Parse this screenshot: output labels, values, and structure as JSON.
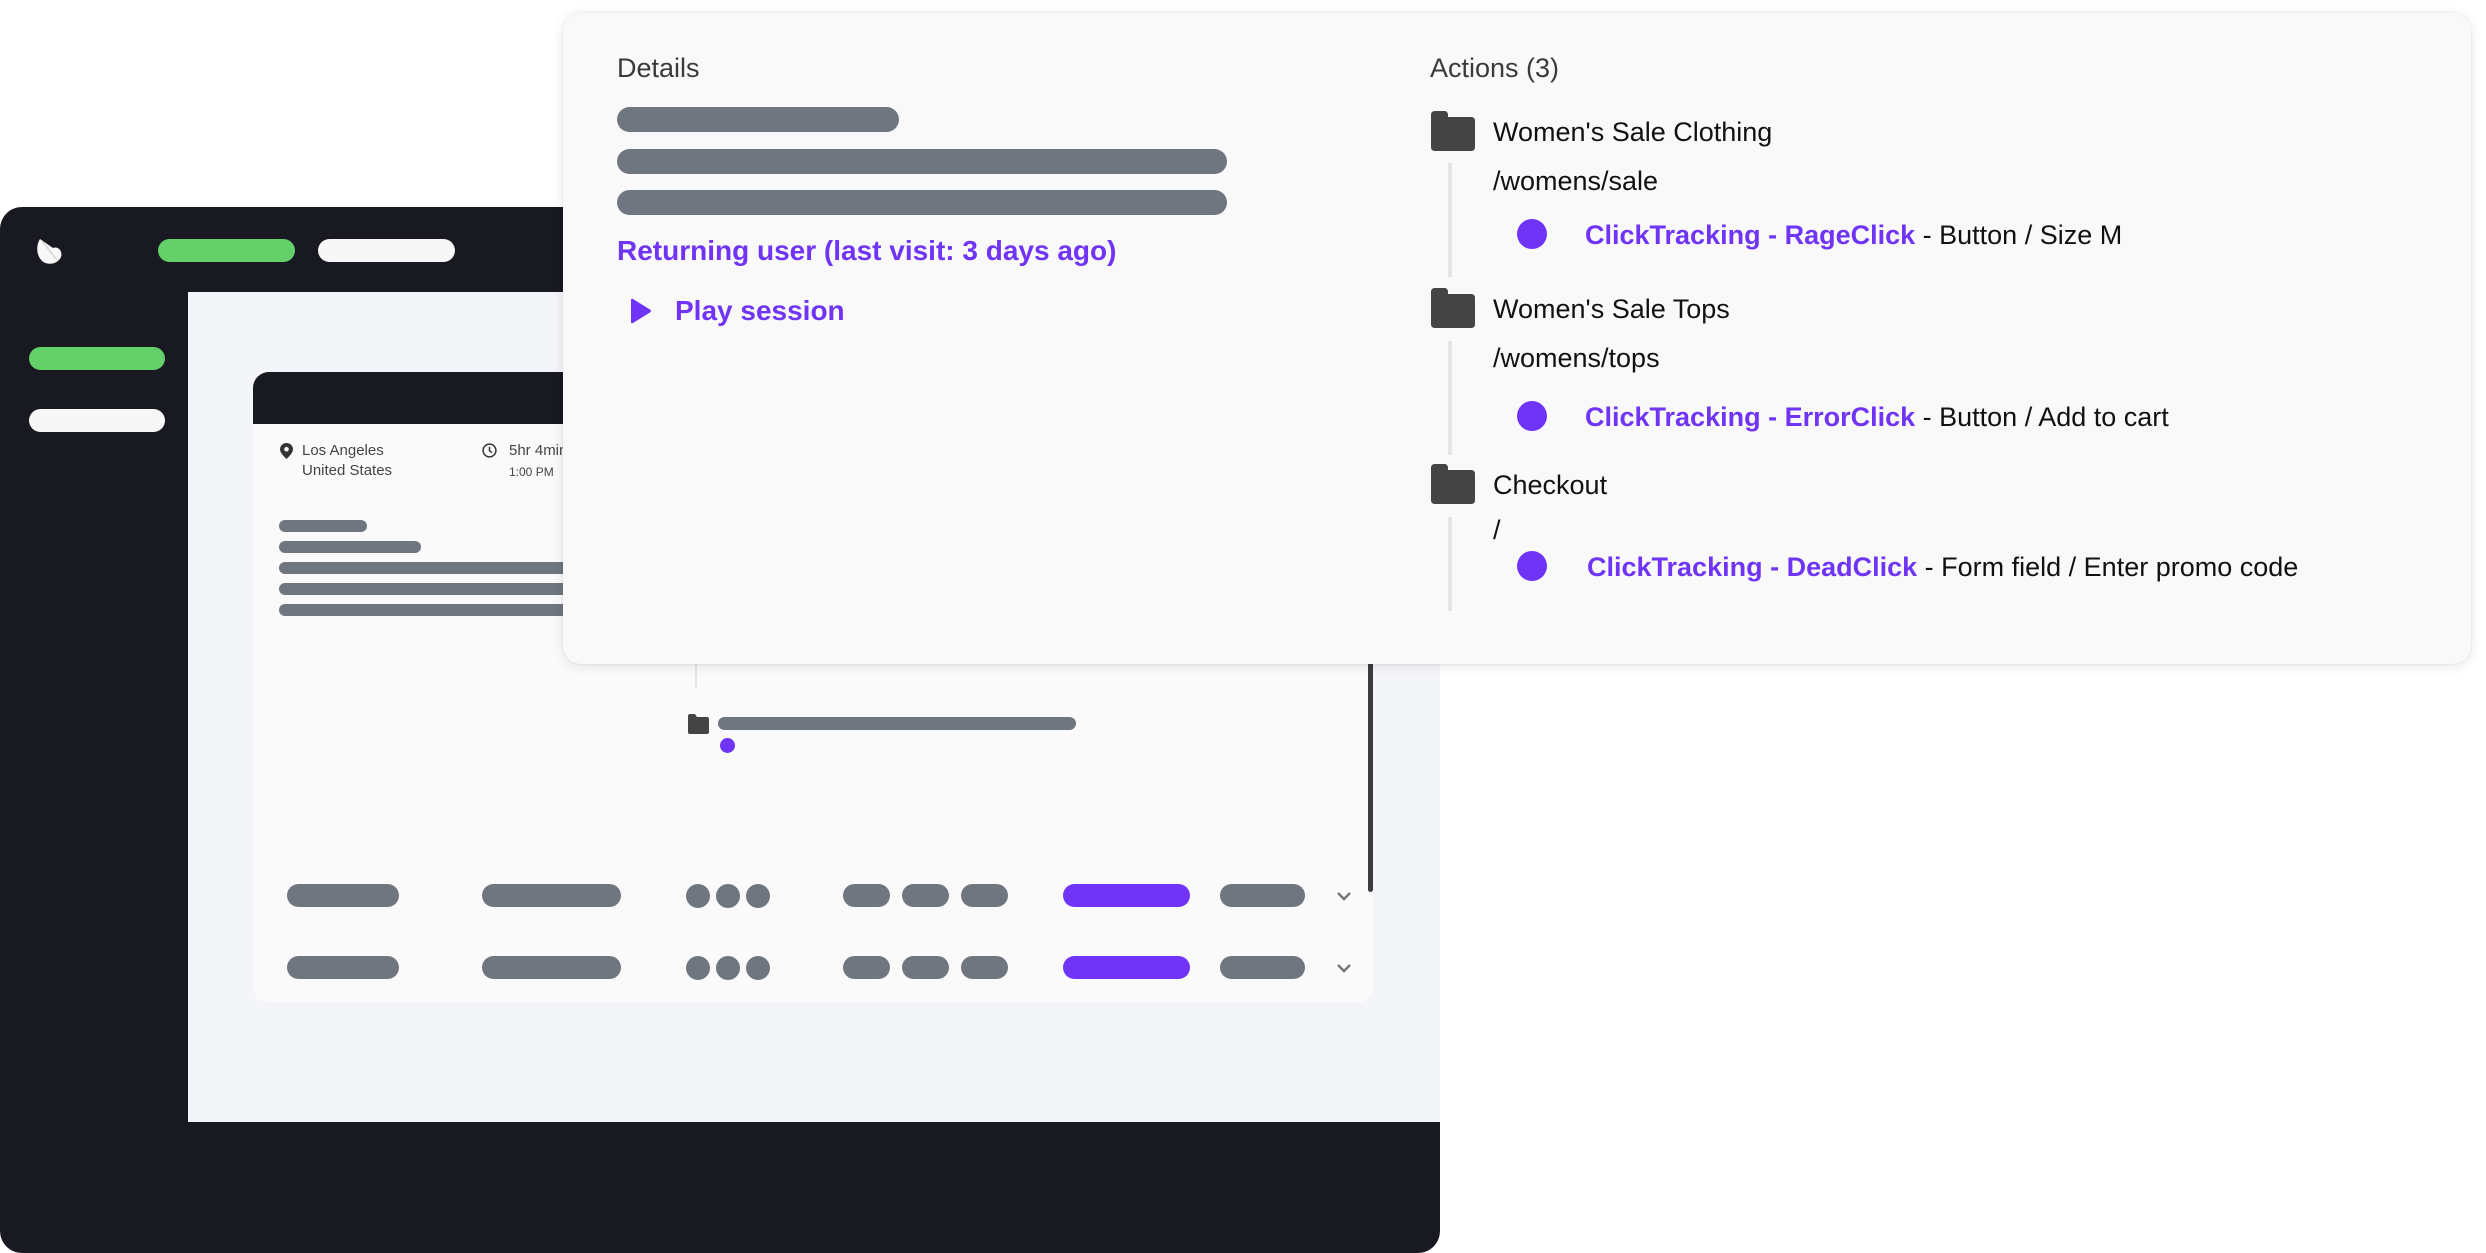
{
  "colors": {
    "accent": "#6f34f5",
    "success": "#64d06a",
    "dark": "#181921",
    "skeleton": "#6f7680",
    "folder": "#444444"
  },
  "app": {
    "logo_icon": "brand-logo-icon",
    "nav_pills": [
      "active-nav-item",
      "nav-item"
    ],
    "sidebar_pills": [
      "active-sidebar-item",
      "sidebar-item"
    ]
  },
  "session_card": {
    "location": {
      "icon": "map-pin-icon",
      "city": "Los Angeles",
      "country": "United States"
    },
    "duration": {
      "icon": "clock-icon",
      "length": "5hr 4min",
      "time": "1:00 PM"
    },
    "rows": 2
  },
  "details": {
    "title": "Details",
    "returning_user": "Returning user (last visit: 3 days ago)",
    "play_session": "Play session",
    "play_icon": "play-icon"
  },
  "actions": {
    "title": "Actions (3)",
    "pages": [
      {
        "name": "Women's Sale Clothing",
        "path": "/womens/sale",
        "event": {
          "name": "ClickTracking - RageClick",
          "detail": " - Button / Size M"
        }
      },
      {
        "name": "Women's Sale Tops",
        "path": "/womens/tops",
        "event": {
          "name": "ClickTracking - ErrorClick",
          "detail": " - Button / Add to cart"
        }
      },
      {
        "name": "Checkout",
        "path": "/",
        "event": {
          "name": "ClickTracking - DeadClick",
          "detail": " - Form field / Enter promo code"
        }
      }
    ]
  }
}
